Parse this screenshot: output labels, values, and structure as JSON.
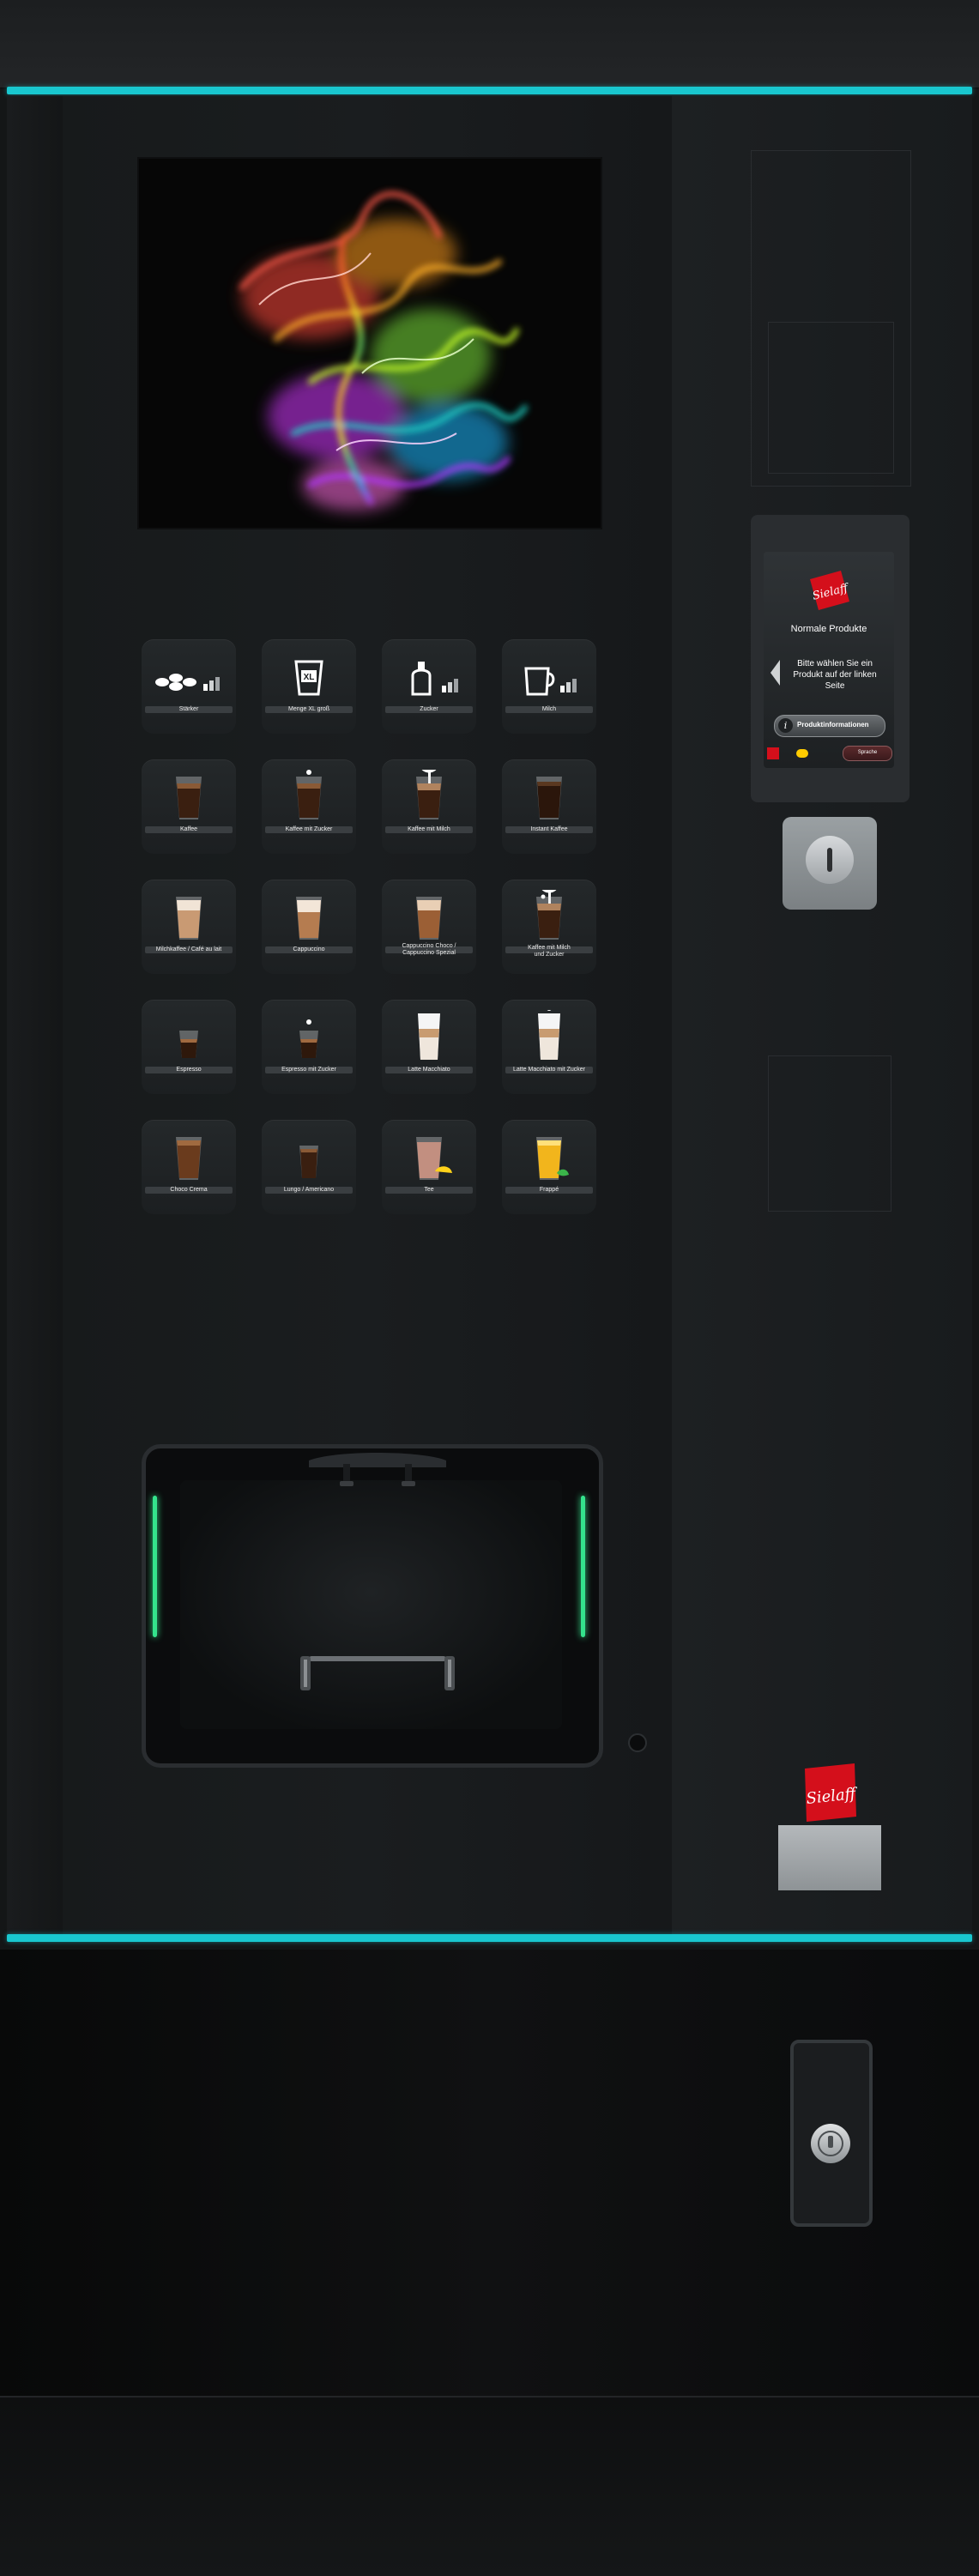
{
  "colors": {
    "accent": "#19c7cf",
    "cabinet": "#141617",
    "tile": "#212527",
    "brand_red": "#d40f1b",
    "indicator_green": "#34e38c"
  },
  "products": [
    {
      "label": "Stärker",
      "icon": "coffee-beans-strength-icon"
    },
    {
      "label": "Menge XL groß",
      "icon": "xl-cup-size-icon"
    },
    {
      "label": "Zucker",
      "icon": "sugar-dispenser-icon"
    },
    {
      "label": "Milch",
      "icon": "milk-jug-icon"
    },
    {
      "label": "Kaffee",
      "icon": "black-coffee-cup-icon"
    },
    {
      "label": "Kaffee mit Zucker",
      "icon": "coffee-sugar-cup-icon"
    },
    {
      "label": "Kaffee mit Milch",
      "icon": "coffee-milk-cup-icon"
    },
    {
      "label": "Instant Kaffee",
      "icon": "instant-coffee-cup-icon"
    },
    {
      "label": "Milchkaffee / Café au lait",
      "icon": "milk-coffee-cup-icon"
    },
    {
      "label": "Cappuccino",
      "icon": "cappuccino-cup-icon"
    },
    {
      "label": "Cappuccino Choco /\nCappuccino Spezial",
      "icon": "cappuccino-choco-cup-icon"
    },
    {
      "label": "Kaffee mit Milch\nund Zucker",
      "icon": "coffee-milk-sugar-cup-icon"
    },
    {
      "label": "Espresso",
      "icon": "espresso-cup-icon"
    },
    {
      "label": "Espresso mit Zucker",
      "icon": "espresso-sugar-cup-icon"
    },
    {
      "label": "Latte Macchiato",
      "icon": "latte-macchiato-glass-icon"
    },
    {
      "label": "Latte Macchiato mit Zucker",
      "icon": "latte-macchiato-sugar-glass-icon"
    },
    {
      "label": "Choco Crema",
      "icon": "choco-crema-cup-icon"
    },
    {
      "label": "Lungo / Americano",
      "icon": "lungo-cup-icon"
    },
    {
      "label": "Tee",
      "icon": "tea-glass-lemon-icon"
    },
    {
      "label": "Frappé",
      "icon": "frappe-glass-mint-icon"
    }
  ],
  "touchscreen": {
    "logo": "Sielaff",
    "title": "Normale Produkte",
    "prompt": "Bitte wählen Sie ein Produkt auf der linken Seite",
    "info_button": "Produktinformationen",
    "lang_button": "Sprache",
    "left_arrow_icon": "arrow-left-icon"
  },
  "brand": {
    "logo_text": "Sielaff"
  },
  "icons": {
    "coin_slot": "coin-slot-icon",
    "lock": "lock-icon",
    "info": "info-icon"
  }
}
